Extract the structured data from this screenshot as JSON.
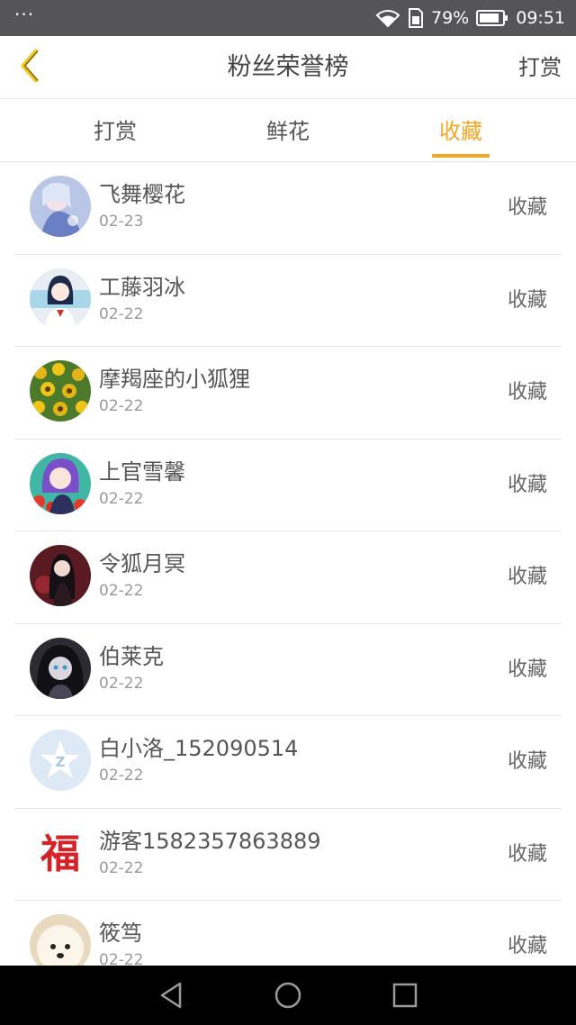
{
  "status_bar": {
    "dots": "···",
    "battery_percent": "79%",
    "time": "09:51",
    "icons": [
      "wifi-icon",
      "sim-icon",
      "battery-icon"
    ]
  },
  "header": {
    "title": "粉丝荣誉榜",
    "action_label": "打赏"
  },
  "tabs": [
    {
      "label": "打赏",
      "active": false
    },
    {
      "label": "鲜花",
      "active": false
    },
    {
      "label": "收藏",
      "active": true
    }
  ],
  "accent_color": "#f5a623",
  "list": [
    {
      "name": "飞舞樱花",
      "date": "02-23",
      "action": "收藏"
    },
    {
      "name": "工藤羽冰",
      "date": "02-22",
      "action": "收藏"
    },
    {
      "name": "摩羯座的小狐狸",
      "date": "02-22",
      "action": "收藏"
    },
    {
      "name": "上官雪馨",
      "date": "02-22",
      "action": "收藏"
    },
    {
      "name": "令狐月冥",
      "date": "02-22",
      "action": "收藏"
    },
    {
      "name": "伯莱克",
      "date": "02-22",
      "action": "收藏"
    },
    {
      "name": "白小洛_152090514",
      "date": "02-22",
      "action": "收藏"
    },
    {
      "name": "游客1582357863889",
      "date": "02-22",
      "action": "收藏"
    },
    {
      "name": "筱笃",
      "date": "02-22",
      "action": "收藏"
    }
  ],
  "avatar_glyphs": {
    "row7": "Z",
    "row8": "福"
  },
  "system_nav": [
    "back-triangle-icon",
    "home-circle-icon",
    "recents-square-icon"
  ]
}
